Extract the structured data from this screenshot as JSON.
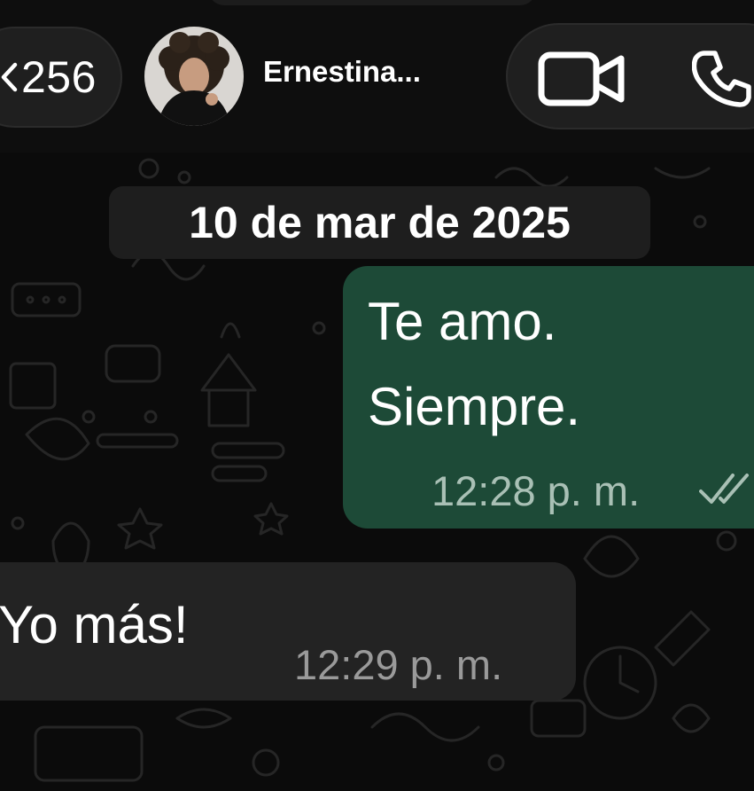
{
  "header": {
    "back_count": "256",
    "contact_name": "Ernestina...",
    "back_icon": "chevron-left-icon",
    "video_icon": "video-camera-icon",
    "call_icon": "phone-icon"
  },
  "chat": {
    "date_separator": "10 de mar de 2025",
    "messages": [
      {
        "direction": "outgoing",
        "lines": [
          "Te amo.",
          "Siempre."
        ],
        "time": "12:28 p. m.",
        "status_icon": "double-check-icon"
      },
      {
        "direction": "incoming",
        "lines": [
          "Yo más!"
        ],
        "time": "12:29 p. m."
      }
    ]
  },
  "colors": {
    "background": "#0b0b0b",
    "header": "#0e0e0e",
    "outgoing_bubble": "#1d4a37",
    "incoming_bubble": "#232323",
    "date_chip": "#1e1e1e",
    "text": "#ffffff"
  }
}
